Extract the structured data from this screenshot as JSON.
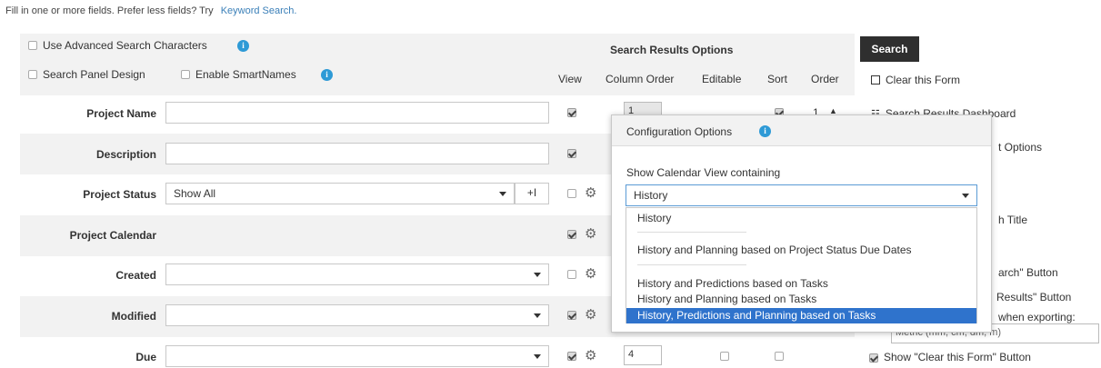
{
  "intro": {
    "text": "Fill in one or more fields. Prefer less fields? Try",
    "link": "Keyword Search."
  },
  "options": {
    "advanced_chars": "Use Advanced Search Characters",
    "panel_design": "Search Panel Design",
    "smartnames": "Enable SmartNames"
  },
  "results_options": {
    "title": "Search Results Options",
    "cols": {
      "view": "View",
      "column_order": "Column Order",
      "editable": "Editable",
      "sort": "Sort",
      "order": "Order"
    }
  },
  "fields": {
    "project_name": "Project Name",
    "description": "Description",
    "project_status": {
      "label": "Project Status",
      "value": "Show All"
    },
    "project_calendar": "Project Calendar",
    "created": "Created",
    "modified": "Modified",
    "due": "Due"
  },
  "row_values": {
    "project_name_order": "1",
    "project_name_sort_order": "1",
    "due_order": "4"
  },
  "right": {
    "search": "Search",
    "clear": "Clear this Form",
    "dashboard": "Search Results Dashboard",
    "r1": "t Options",
    "r2": "h Title",
    "r3": "arch\" Button",
    "r4": "Results\" Button",
    "r5": "when exporting:",
    "metric": "Metric (mm, cm, dm, m)",
    "clear_btn": "Show \"Clear this Form\" Button"
  },
  "popup": {
    "title": "Configuration Options",
    "label": "Show Calendar View containing",
    "selected": "History",
    "options": [
      "History",
      "History and Planning based on Project Status Due Dates",
      "History and Predictions based on Tasks",
      "History and Planning based on Tasks",
      "History, Predictions and Planning based on Tasks"
    ]
  },
  "colors": {
    "accent": "#2f73cc",
    "info": "#2e9ad6",
    "button": "#2f2f2f",
    "link": "#3a7fb8"
  }
}
